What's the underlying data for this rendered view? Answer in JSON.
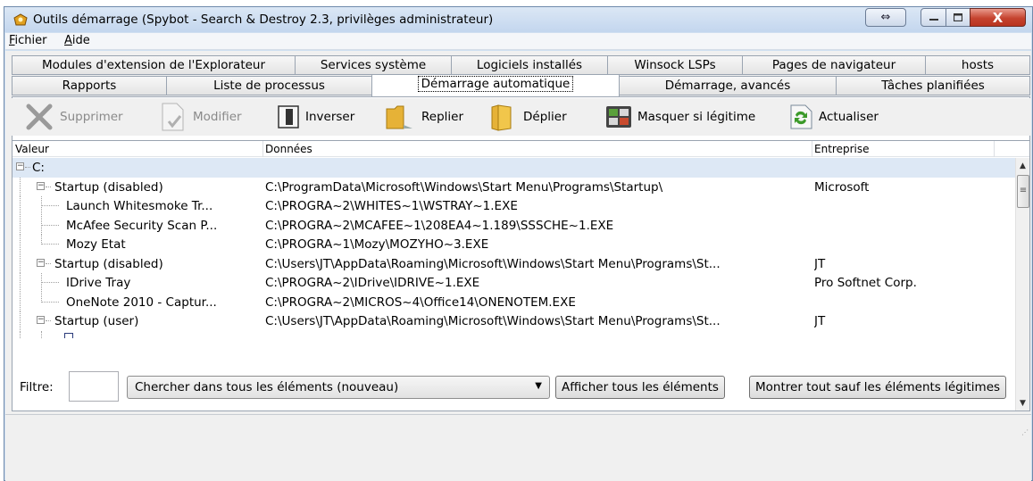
{
  "window": {
    "title": "Outils démarrage (Spybot - Search & Destroy 2.3, privilèges administrateur)",
    "controls": {
      "swap": "⇔",
      "minimize": "—",
      "maximize": "□",
      "close": "X"
    }
  },
  "menu": {
    "items": [
      "Fichier",
      "Aide"
    ]
  },
  "tabs": {
    "row1": [
      "Modules d'extension de l'Explorateur",
      "Services système",
      "Logiciels installés",
      "Winsock LSPs",
      "Pages de navigateur",
      "hosts"
    ],
    "row2": [
      "Rapports",
      "Liste de processus",
      "Démarrage automatique",
      "Démarrage, avancés",
      "Tâches planifiées"
    ]
  },
  "toolbar": {
    "delete": "Supprimer",
    "modify": "Modifier",
    "invert": "Inverser",
    "collapse": "Replier",
    "expand": "Déplier",
    "hide_legit": "Masquer si légitime",
    "refresh": "Actualiser"
  },
  "list": {
    "columns": [
      "Valeur",
      "Données",
      "Entreprise"
    ],
    "rows": [
      {
        "value": "C:",
        "data": "",
        "company": ""
      },
      {
        "value": "Startup (disabled)",
        "data": "C:\\ProgramData\\Microsoft\\Windows\\Start Menu\\Programs\\Startup\\",
        "company": "Microsoft"
      },
      {
        "value": "Launch Whitesmoke Tr...",
        "data": "C:\\PROGRA~2\\WHITES~1\\WSTRAY~1.EXE",
        "company": ""
      },
      {
        "value": "McAfee Security Scan P...",
        "data": "C:\\PROGRA~2\\MCAFEE~1\\208EA4~1.189\\SSSCHE~1.EXE",
        "company": ""
      },
      {
        "value": "Mozy Etat",
        "data": "C:\\PROGRA~1\\Mozy\\MOZYHO~3.EXE",
        "company": ""
      },
      {
        "value": "Startup (disabled)",
        "data": "C:\\Users\\JT\\AppData\\Roaming\\Microsoft\\Windows\\Start Menu\\Programs\\St...",
        "company": "JT"
      },
      {
        "value": "IDrive Tray",
        "data": "C:\\PROGRA~2\\IDrive\\IDRIVE~1.EXE",
        "company": "Pro Softnet Corp."
      },
      {
        "value": "OneNote 2010 - Captur...",
        "data": "C:\\PROGRA~2\\MICROS~4\\Office14\\ONENOTEM.EXE",
        "company": ""
      },
      {
        "value": "Startup (user)",
        "data": "C:\\Users\\JT\\AppData\\Roaming\\Microsoft\\Windows\\Start Menu\\Programs\\St...",
        "company": "JT"
      }
    ]
  },
  "filter": {
    "label": "Filtre:",
    "input_value": "",
    "select_value": "Chercher dans tous les éléments (nouveau)",
    "show_all": "Afficher tous les éléments",
    "show_except_legit": "Montrer tout sauf les éléments légitimes"
  }
}
